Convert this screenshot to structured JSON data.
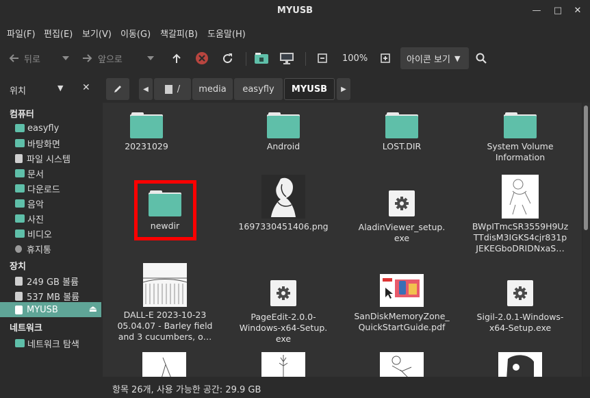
{
  "window": {
    "title": "MYUSB"
  },
  "menu": [
    "파일(F)",
    "편집(E)",
    "보기(V)",
    "이동(G)",
    "책갈피(B)",
    "도움말(H)"
  ],
  "toolbar": {
    "back_label": "뒤로",
    "forward_label": "앞으로",
    "zoom": "100%",
    "view_mode": "아이콘 보기"
  },
  "sidebar": {
    "header": "위치",
    "sections": [
      {
        "title": "컴퓨터",
        "items": [
          "easyfly",
          "바탕화면",
          "파일 시스템",
          "문서",
          "다운로드",
          "음악",
          "사진",
          "비디오",
          "휴지통"
        ]
      },
      {
        "title": "장치",
        "items": [
          "249 GB 볼륨",
          "537 MB 볼륨",
          "MYUSB"
        ]
      },
      {
        "title": "네트워크",
        "items": [
          "네트워크 탐색"
        ]
      }
    ],
    "active_item": "MYUSB"
  },
  "path": {
    "root": "/",
    "segments": [
      "media",
      "easyfly",
      "MYUSB"
    ]
  },
  "files": [
    {
      "name": "20231029",
      "type": "folder"
    },
    {
      "name": "Android",
      "type": "folder"
    },
    {
      "name": "LOST.DIR",
      "type": "folder"
    },
    {
      "name": "System Volume Information",
      "type": "folder"
    },
    {
      "name": "newdir",
      "type": "folder",
      "highlighted": true
    },
    {
      "name": "1697330451406.png",
      "type": "image"
    },
    {
      "name": "AladinViewer_setup.exe",
      "type": "exe"
    },
    {
      "name": "BWpITmcSR3559H9UzTTdisM3IGKS4cjr831pJEKEGboDRIDNxaS…",
      "type": "image"
    },
    {
      "name": "DALL-E 2023-10-23 05.04.07 - Barley field and 3 cucumbers, o…",
      "type": "image"
    },
    {
      "name": "PageEdit-2.0.0-Windows-x64-Setup.exe",
      "type": "exe"
    },
    {
      "name": "SanDiskMemoryZone_QuickStartGuide.pdf",
      "type": "pdf"
    },
    {
      "name": "Sigil-2.0.1-Windows-x64-Setup.exe",
      "type": "exe"
    }
  ],
  "file_labels": {
    "f0": "20231029",
    "f1": "Android",
    "f2": "LOST.DIR",
    "f3a": "System Volume",
    "f3b": "Information",
    "f4": "newdir",
    "f5": "1697330451406.png",
    "f6a": "AladinViewer_setup.",
    "f6b": "exe",
    "f7a": "BWpITmcSR3559H9Uz",
    "f7b": "TTdisM3IGKS4cjr831p",
    "f7c": "JEKEGboDRIDNxaS…",
    "f8a": "DALL-E 2023-10-23",
    "f8b": "05.04.07 - Barley field",
    "f8c": "and 3 cucumbers, o…",
    "f9a": "PageEdit-2.0.0-",
    "f9b": "Windows-x64-Setup.",
    "f9c": "exe",
    "f10a": "SanDiskMemoryZone_",
    "f10b": "QuickStartGuide.pdf",
    "f11a": "Sigil-2.0.1-Windows-",
    "f11b": "x64-Setup.exe"
  },
  "status": "항목 26개, 사용 가능한 공간: 29.9 GB",
  "colors": {
    "accent": "#5fa597",
    "folder": "#5fbfa9",
    "highlight": "#ff0000"
  }
}
